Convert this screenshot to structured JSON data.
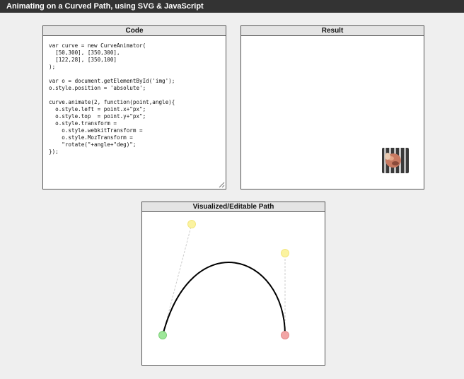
{
  "page": {
    "title": "Animating on a Curved Path, using SVG & JavaScript"
  },
  "code_panel": {
    "title": "Code",
    "code": "var curve = new CurveAnimator(\n  [50,300], [350,300],\n  [122,28], [350,100]\n);\n\nvar o = document.getElementById('img');\no.style.position = 'absolute';\n\ncurve.animate(2, function(point,angle){\n  o.style.left = point.x+\"px\";\n  o.style.top  = point.y+\"px\";\n  o.style.transform =\n    o.style.webkitTransform =\n    o.style.MozTransform =\n    \"rotate(\"+angle+\"deg)\";\n});"
  },
  "result_panel": {
    "title": "Result"
  },
  "path_panel": {
    "title": "Visualized/Editable Path"
  },
  "colors": {
    "start_handle": "#9ee79a",
    "end_handle": "#f2a6a6",
    "control_handle": "#fbf3a0",
    "curve_stroke": "#000000",
    "guide_stroke": "#cccccc"
  }
}
